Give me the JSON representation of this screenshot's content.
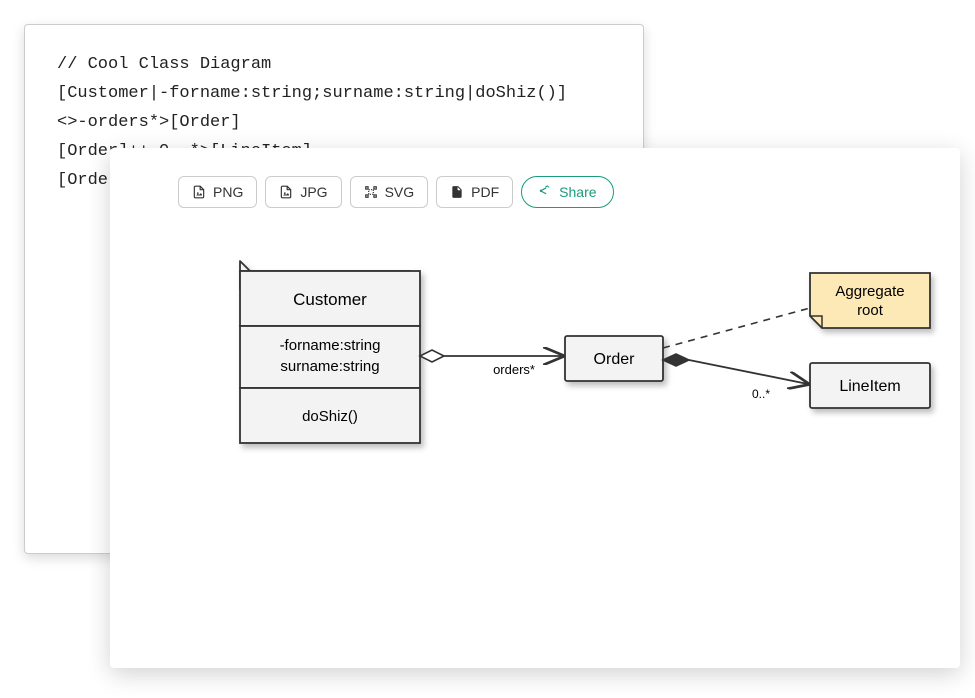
{
  "code": {
    "line1": "// Cool Class Diagram",
    "line2": "[Customer|-forname:string;surname:string|doShiz()]",
    "line3": "<>-orders*>[Order]",
    "line4": "[Order]++-0..*>[LineItem]",
    "line5": "[Order]-"
  },
  "toolbar": {
    "png": "PNG",
    "jpg": "JPG",
    "svg": "SVG",
    "pdf": "PDF",
    "share": "Share"
  },
  "diagram": {
    "customer": {
      "title": "Customer",
      "attr1": "-forname:string",
      "attr2": "surname:string",
      "method": "doShiz()"
    },
    "order": {
      "title": "Order",
      "edge_label": "orders*"
    },
    "lineitem": {
      "title": "LineItem",
      "multiplicity": "0..*"
    },
    "note": {
      "line1": "Aggregate",
      "line2": "root"
    }
  }
}
